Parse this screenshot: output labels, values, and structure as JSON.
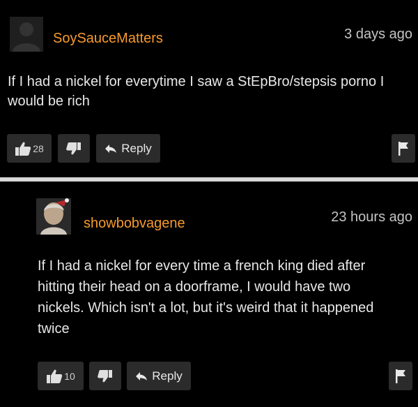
{
  "comments": [
    {
      "username": "SoySauceMatters",
      "timestamp": "3 days ago",
      "text": "If I had a nickel for everytime I saw a StEpBro/stepsis porno I would be rich",
      "likes": "28",
      "reply_label": "Reply",
      "avatar_icon": "default-user-silhouette"
    },
    {
      "username": "showbobvagene",
      "timestamp": "23 hours ago",
      "text": "If I had a nickel for every time a french king died after hitting their head on a doorframe, I would have two nickels. Which isn't a lot, but it's weird that it happened twice",
      "likes": "10",
      "reply_label": "Reply",
      "avatar_icon": "user-photo"
    }
  ],
  "colors": {
    "username": "#f79b2c",
    "button_bg": "#2b2b2b",
    "background": "#000000"
  }
}
